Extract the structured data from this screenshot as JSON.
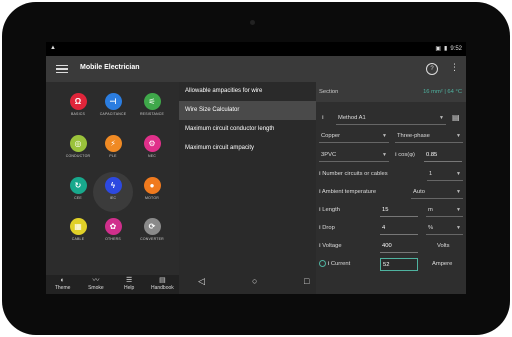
{
  "statusbar": {
    "warning_icon": "warning-icon",
    "time": "9:52"
  },
  "appbar": {
    "title": "Mobile Electrician",
    "help": "?",
    "more": "⋮"
  },
  "tiles": [
    {
      "label": "BASICS",
      "glyph": "Ω",
      "color": "#e0253a"
    },
    {
      "label": "CAPACITANCE",
      "glyph": "⊣",
      "color": "#2b7de0"
    },
    {
      "label": "RESISTANCE",
      "glyph": "⚟",
      "color": "#3fa84a"
    },
    {
      "label": "CONDUCTOR",
      "glyph": "◎",
      "color": "#9ac23b"
    },
    {
      "label": "PLE",
      "glyph": "⚡",
      "color": "#f08a24"
    },
    {
      "label": "NEC",
      "glyph": "⚙",
      "color": "#e0308a"
    },
    {
      "label": "CEE",
      "glyph": "↻",
      "color": "#18a88c"
    },
    {
      "label": "IEC",
      "glyph": "ϟ",
      "color": "#2d49e0"
    },
    {
      "label": "MOTOR",
      "glyph": "●",
      "color": "#f07a1e"
    },
    {
      "label": "CABLE",
      "glyph": "▦",
      "color": "#e0d028"
    },
    {
      "label": "OTHERS",
      "glyph": "✿",
      "color": "#d02f8c"
    },
    {
      "label": "CONVERTER",
      "glyph": "⟳",
      "color": "#8a8a8a"
    }
  ],
  "bottomnav": [
    {
      "label": "Theme",
      "glyph": "◐"
    },
    {
      "label": "Smoke",
      "glyph": "〰"
    },
    {
      "label": "Help",
      "glyph": "☰"
    },
    {
      "label": "Handbook",
      "glyph": "▤"
    }
  ],
  "menu": [
    "Allowable ampacities for wire",
    "Wire Size Calculator",
    "Maximum circuit conductor length",
    "Maximum circuit ampacity"
  ],
  "panel": {
    "section_label": "Section",
    "section_value": "16 mm² | 64 °C",
    "method": "Method A1",
    "material": "Copper",
    "phase": "Three-phase",
    "insulation": "3PVC",
    "cos_label": "cos(φ)",
    "cos_value": "0.85",
    "circuits_label": "Number circuits or cables",
    "circuits_value": "1",
    "ambient_label": "Ambient temperature",
    "ambient_value": "Auto",
    "length_label": "Length",
    "length_value": "15",
    "length_unit": "m",
    "drop_label": "Drop",
    "drop_value": "4",
    "drop_unit": "%",
    "voltage_label": "Voltage",
    "voltage_value": "400",
    "voltage_unit": "Volts",
    "current_label": "Current",
    "current_value": "52",
    "current_unit": "Ampere"
  },
  "system_nav": {
    "back": "◁",
    "home": "○",
    "recent": "□"
  },
  "colors": {
    "accent": "#4fb3a0"
  }
}
